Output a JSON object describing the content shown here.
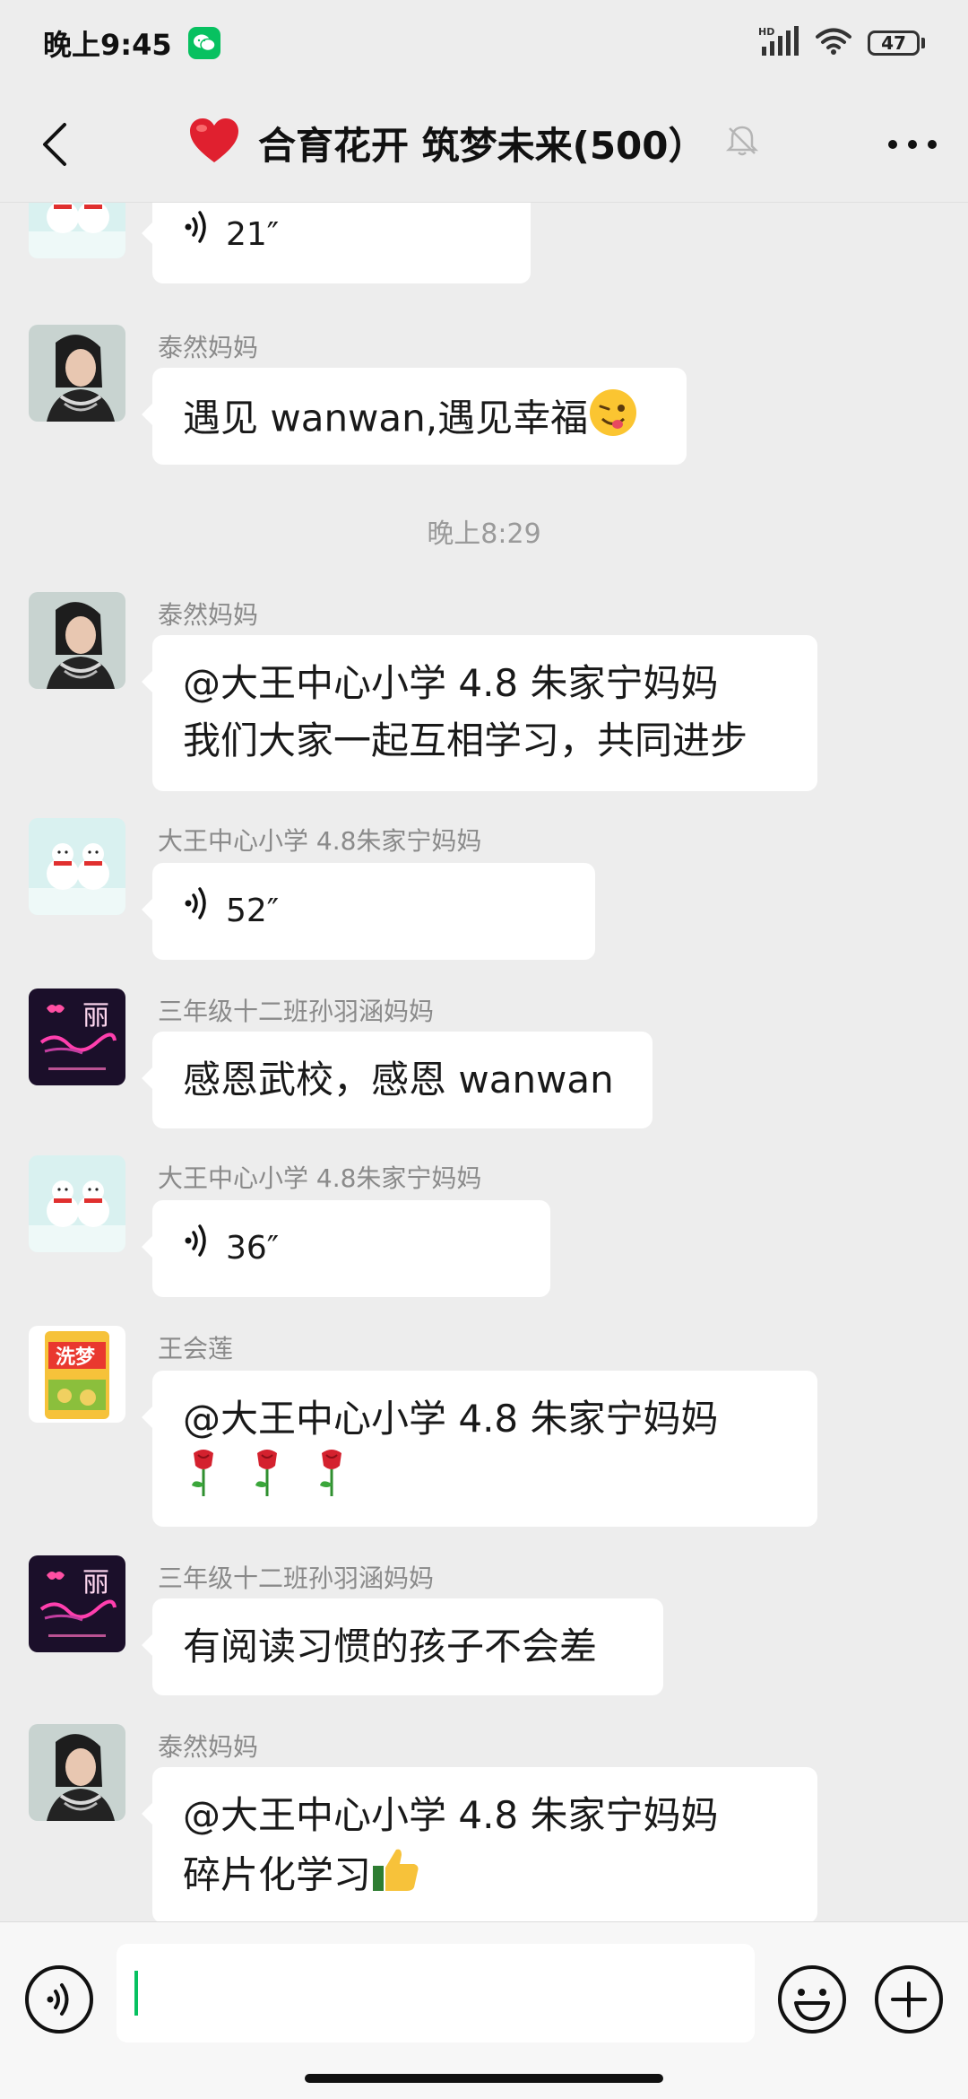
{
  "status": {
    "time": "晚上9:45",
    "battery": "47",
    "network_badge": "HD"
  },
  "header": {
    "title": "合育花开 筑梦未来(500）"
  },
  "messages": [
    {
      "type": "voice",
      "duration": "21″"
    },
    {
      "sender": "泰然妈妈",
      "type": "text",
      "lines": [
        "遇见 wanwan,遇见幸福"
      ]
    },
    {
      "type": "time",
      "text": "晚上8:29"
    },
    {
      "sender": "泰然妈妈",
      "type": "text",
      "lines": [
        "@大王中心小学 4.8 朱家宁妈妈",
        "我们大家一起互相学习，共同进步"
      ]
    },
    {
      "sender": "大王中心小学 4.8朱家宁妈妈",
      "type": "voice",
      "duration": "52″"
    },
    {
      "sender": "三年级十二班孙羽涵妈妈",
      "type": "text",
      "lines": [
        "感恩武校，感恩 wanwan"
      ]
    },
    {
      "sender": "大王中心小学 4.8朱家宁妈妈",
      "type": "voice",
      "duration": "36″"
    },
    {
      "sender": "王会莲",
      "type": "text",
      "lines": [
        "@大王中心小学 4.8 朱家宁妈妈"
      ]
    },
    {
      "sender": "三年级十二班孙羽涵妈妈",
      "type": "text",
      "lines": [
        "有阅读习惯的孩子不会差"
      ]
    },
    {
      "sender": "泰然妈妈",
      "type": "text",
      "lines": [
        "@大王中心小学 4.8 朱家宁妈妈",
        "碎片化学习"
      ]
    }
  ],
  "avatars": {
    "lily_text": "丽",
    "rice_brand": "洗梦"
  },
  "colors": {
    "accent": "#07c160",
    "background": "#ededed",
    "bubble": "#ffffff"
  },
  "icons": [
    "back-arrow-icon",
    "mute-bell-icon",
    "more-icon",
    "voice-wave-icon",
    "emoji-icon",
    "plus-icon",
    "wechat-icon",
    "signal-icon",
    "wifi-icon",
    "battery-icon"
  ]
}
